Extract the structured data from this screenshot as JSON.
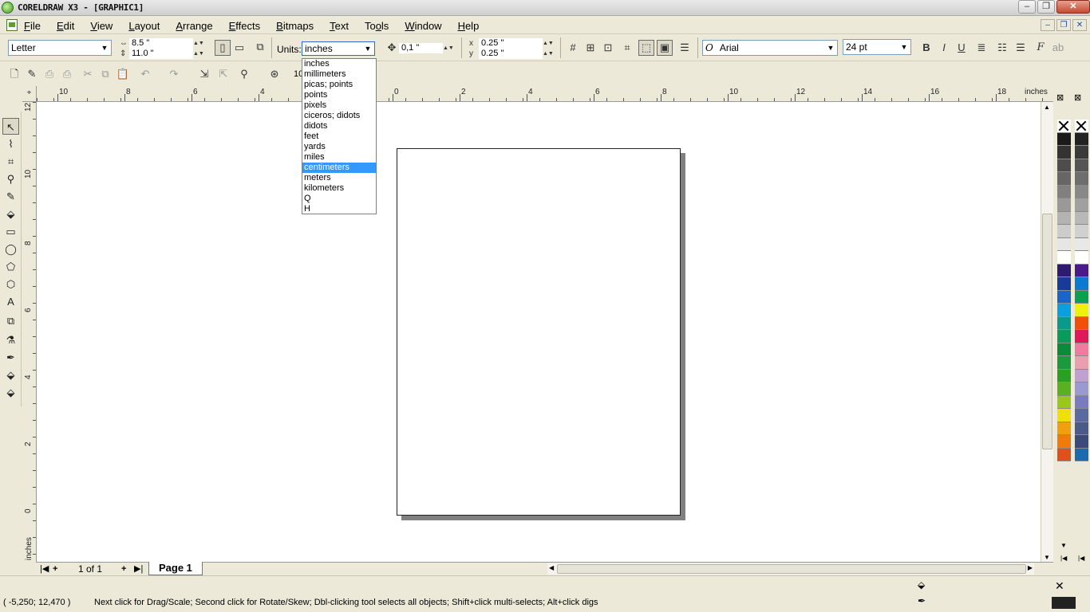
{
  "window": {
    "title": "CORELDRAW X3 - [GRAPHIC1]"
  },
  "menu": [
    {
      "label": "File",
      "acc": "F",
      "rest": "ile"
    },
    {
      "label": "Edit",
      "acc": "E",
      "rest": "dit"
    },
    {
      "label": "View",
      "acc": "V",
      "rest": "iew"
    },
    {
      "label": "Layout",
      "acc": "L",
      "rest": "ayout"
    },
    {
      "label": "Arrange",
      "acc": "A",
      "rest": "rrange"
    },
    {
      "label": "Effects",
      "acc": "E",
      "rest": "ffects"
    },
    {
      "label": "Bitmaps",
      "acc": "B",
      "rest": "itmaps"
    },
    {
      "label": "Text",
      "acc": "T",
      "rest": "ext"
    },
    {
      "label": "Tools",
      "pre": "To",
      "acc": "o",
      "rest": "ls"
    },
    {
      "label": "Window",
      "acc": "W",
      "rest": "indow"
    },
    {
      "label": "Help",
      "acc": "H",
      "rest": "elp"
    }
  ],
  "propbar": {
    "paper_size": "Letter",
    "width": "8.5 \"",
    "height": "11.0 \"",
    "units_label": "Units:",
    "units_value": "inches",
    "nudge": "0,1 \"",
    "dup_x": "0.25 \"",
    "dup_y": "0.25 \"",
    "font_name": "Arial",
    "font_size": "24 pt"
  },
  "units_options": [
    "inches",
    "millimeters",
    "picas; points",
    "points",
    "pixels",
    "ciceros; didots",
    "didots",
    "feet",
    "yards",
    "miles",
    "centimeters",
    "meters",
    "kilometers",
    "Q",
    "H"
  ],
  "units_highlighted": "centimeters",
  "ruler": {
    "top_labels": [
      "10",
      "8",
      "6",
      "4",
      "0",
      "2",
      "4",
      "6",
      "8",
      "10",
      "12",
      "14",
      "16",
      "18"
    ],
    "unit": "inches",
    "left_labels": [
      "12",
      "10",
      "8",
      "6",
      "4",
      "2",
      "0"
    ],
    "left_unit": "inches"
  },
  "zoom_partial": "10",
  "pagebar": {
    "page_count": "1 of 1",
    "page_tab": "Page 1"
  },
  "status": {
    "coords": "( -5,250; 12,470 )",
    "hint": "Next click for Drag/Scale; Second click for Rotate/Skew; Dbl-clicking tool selects all objects; Shift+click multi-selects; Alt+click digs"
  },
  "colors": {
    "palette_left": [
      "none",
      "#1a1a1a",
      "#333333",
      "#4d4d4d",
      "#666666",
      "#808080",
      "#999999",
      "#b3b3b3",
      "#cccccc",
      "#e6e6e6",
      "#ffffff",
      "#2e1a6e",
      "#1a3a9a",
      "#1a66c8",
      "#0aa0e0",
      "#0a9a8a",
      "#0a9a5a",
      "#0a8a3a",
      "#1a9a3a",
      "#2aa020",
      "#5ab020",
      "#9ac81a",
      "#f0e00a",
      "#f0a00a",
      "#f07a0a",
      "#e0501a"
    ],
    "palette_right": [
      "none",
      "#222222",
      "#3a3a3a",
      "#555555",
      "#6e6e6e",
      "#888888",
      "#a0a0a0",
      "#b8b8b8",
      "#d0d0d0",
      "#e8e8e8",
      "#ffffff",
      "#4a1a8a",
      "#0a7ad0",
      "#0aa050",
      "#f0f00a",
      "#f0500a",
      "#e01a5a",
      "#f07aa0",
      "#e8a0b0",
      "#c0a0d0",
      "#9a9ad0",
      "#7a7ac0",
      "#5a6aa0",
      "#4a5a8a",
      "#3a4a7a",
      "#1a6ab0"
    ]
  }
}
